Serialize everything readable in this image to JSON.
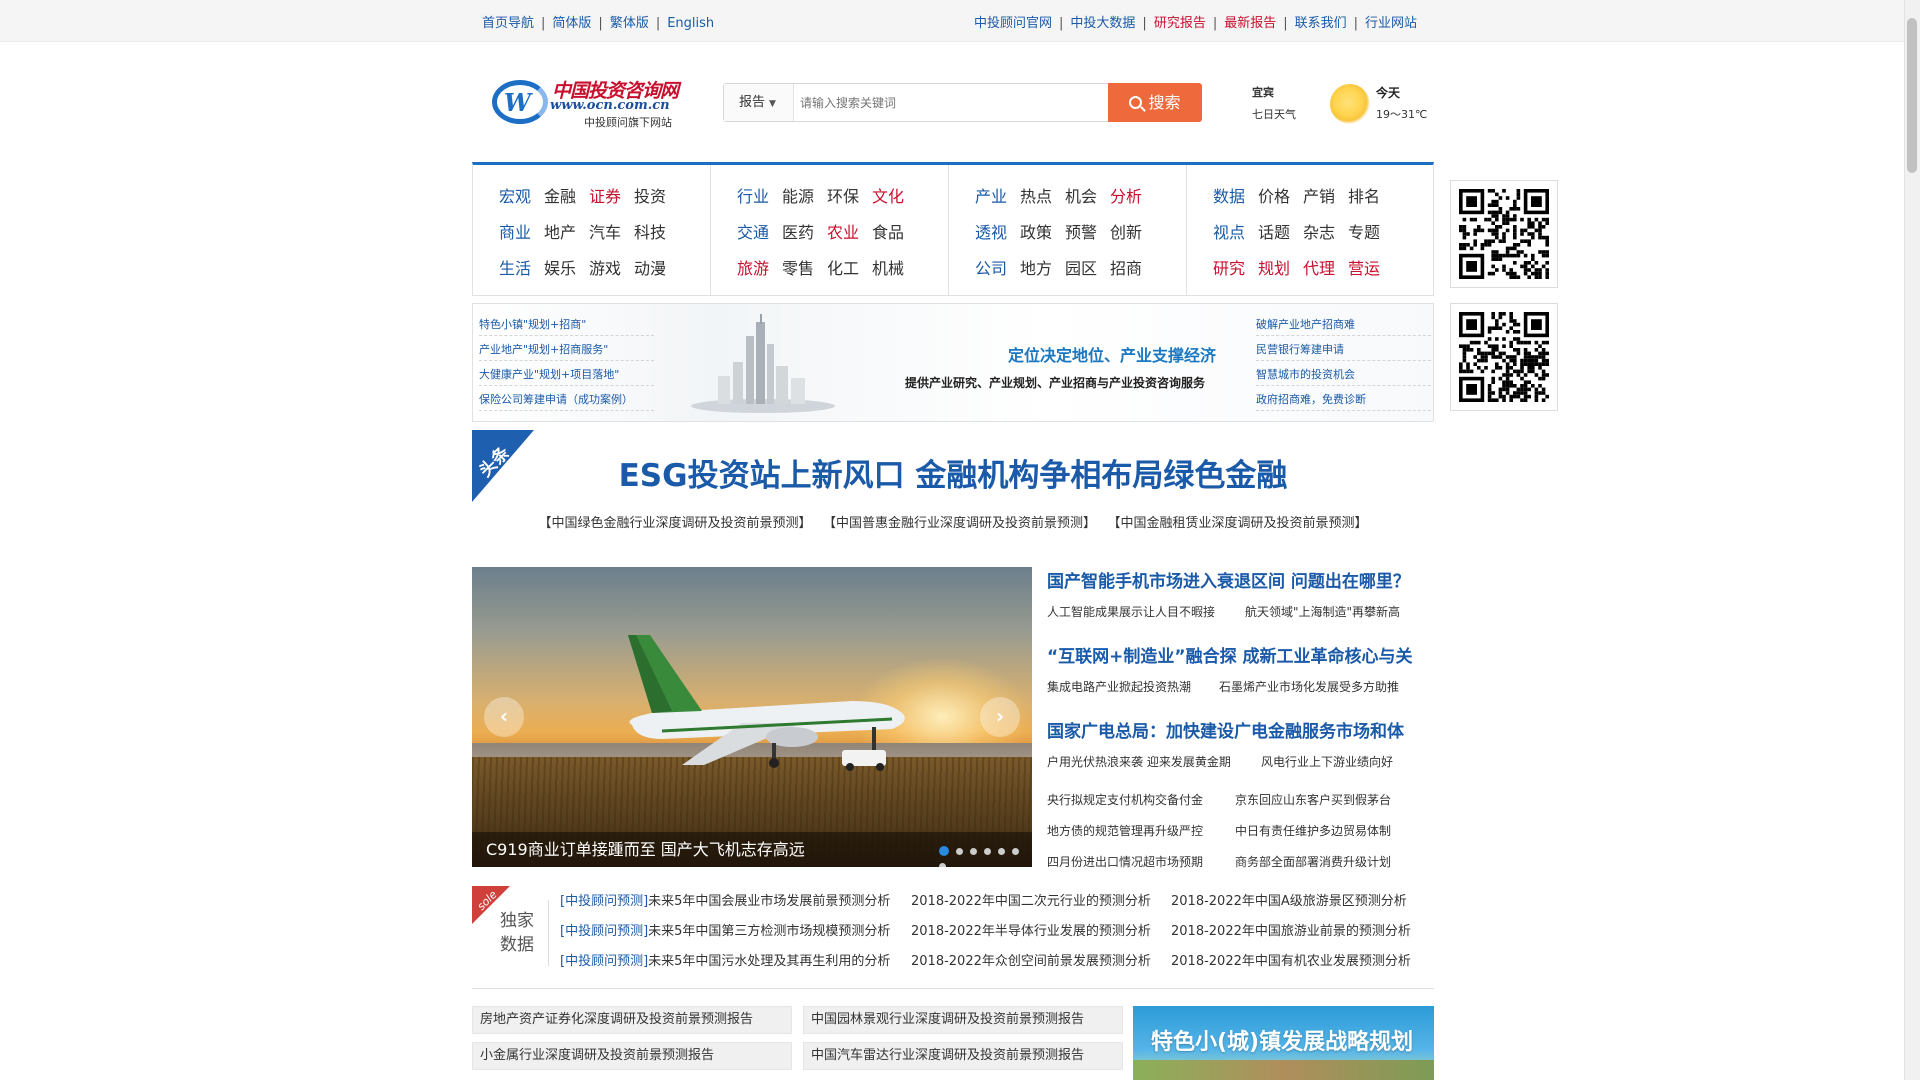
{
  "topbar": {
    "left": [
      "首页导航",
      "简体版",
      "繁体版",
      "English"
    ],
    "right": [
      {
        "label": "中投顾问官网",
        "red": false
      },
      {
        "label": "中投大数据",
        "red": false
      },
      {
        "label": "研究报告",
        "red": true
      },
      {
        "label": "最新报告",
        "red": true
      },
      {
        "label": "联系我们",
        "red": false
      },
      {
        "label": "行业网站",
        "red": false
      }
    ]
  },
  "logo": {
    "name": "中国投资咨询网",
    "url": "www.ocn.com.cn",
    "sub": "中投顾问旗下网站"
  },
  "search": {
    "select_value": "报告",
    "placeholder": "请输入搜索关键词",
    "button": "搜索"
  },
  "weather": {
    "city": "宜宾",
    "label": "七日天气",
    "today": "今天",
    "temp": "19～31℃"
  },
  "categories": [
    [
      [
        {
          "t": "宏观",
          "c": "blue"
        },
        {
          "t": "金融",
          "c": "dark"
        },
        {
          "t": "证券",
          "c": "red"
        },
        {
          "t": "投资",
          "c": "dark"
        }
      ],
      [
        {
          "t": "商业",
          "c": "blue"
        },
        {
          "t": "地产",
          "c": "dark"
        },
        {
          "t": "汽车",
          "c": "dark"
        },
        {
          "t": "科技",
          "c": "dark"
        }
      ],
      [
        {
          "t": "生活",
          "c": "blue"
        },
        {
          "t": "娱乐",
          "c": "dark"
        },
        {
          "t": "游戏",
          "c": "dark"
        },
        {
          "t": "动漫",
          "c": "dark"
        }
      ]
    ],
    [
      [
        {
          "t": "行业",
          "c": "blue"
        },
        {
          "t": "能源",
          "c": "dark"
        },
        {
          "t": "环保",
          "c": "dark"
        },
        {
          "t": "文化",
          "c": "red"
        }
      ],
      [
        {
          "t": "交通",
          "c": "blue"
        },
        {
          "t": "医药",
          "c": "dark"
        },
        {
          "t": "农业",
          "c": "red"
        },
        {
          "t": "食品",
          "c": "dark"
        }
      ],
      [
        {
          "t": "旅游",
          "c": "red"
        },
        {
          "t": "零售",
          "c": "dark"
        },
        {
          "t": "化工",
          "c": "dark"
        },
        {
          "t": "机械",
          "c": "dark"
        }
      ]
    ],
    [
      [
        {
          "t": "产业",
          "c": "blue"
        },
        {
          "t": "热点",
          "c": "dark"
        },
        {
          "t": "机会",
          "c": "dark"
        },
        {
          "t": "分析",
          "c": "red"
        }
      ],
      [
        {
          "t": "透视",
          "c": "blue"
        },
        {
          "t": "政策",
          "c": "dark"
        },
        {
          "t": "预警",
          "c": "dark"
        },
        {
          "t": "创新",
          "c": "dark"
        }
      ],
      [
        {
          "t": "公司",
          "c": "blue"
        },
        {
          "t": "地方",
          "c": "dark"
        },
        {
          "t": "园区",
          "c": "dark"
        },
        {
          "t": "招商",
          "c": "dark"
        }
      ]
    ],
    [
      [
        {
          "t": "数据",
          "c": "blue"
        },
        {
          "t": "价格",
          "c": "dark"
        },
        {
          "t": "产销",
          "c": "dark"
        },
        {
          "t": "排名",
          "c": "dark"
        }
      ],
      [
        {
          "t": "视点",
          "c": "blue"
        },
        {
          "t": "话题",
          "c": "dark"
        },
        {
          "t": "杂志",
          "c": "dark"
        },
        {
          "t": "专题",
          "c": "dark"
        }
      ],
      [
        {
          "t": "研究",
          "c": "red"
        },
        {
          "t": "规划",
          "c": "red"
        },
        {
          "t": "代理",
          "c": "red"
        },
        {
          "t": "营运",
          "c": "red"
        }
      ]
    ]
  ],
  "banner": {
    "left_links": [
      "特色小镇\"规划+招商\"",
      "产业地产\"规划+招商服务\"",
      "大健康产业\"规划+项目落地\"",
      "保险公司筹建申请（成功案例）"
    ],
    "right_links": [
      "破解产业地产招商难",
      "民营银行筹建申请",
      "智慧城市的投资机会",
      "政府招商难，免费诊断"
    ],
    "slogan": "定位决定地位、产业支撑经济",
    "slogan2": "提供产业研究、产业规划、产业招商与产业投资咨询服务"
  },
  "ribbon": "头条",
  "headline": "ESG投资站上新风口 金融机构争相布局绿色金融",
  "reports": [
    "【中国绿色金融行业深度调研及投资前景预测】",
    "【中国普惠金融行业深度调研及投资前景预测】",
    "【中国金融租赁业深度调研及投资前景预测】"
  ],
  "slider": {
    "caption": "C919商业订单接踵而至 国产大飞机志存高远",
    "prev": "‹",
    "next": "›",
    "dot_count": 7,
    "active_dot": 1
  },
  "news": {
    "items": [
      {
        "headline": "国产智能手机市场进入衰退区间 问题出在哪里？",
        "subs": [
          "人工智能成果展示让人目不暇接",
          "航天领域\"上海制造\"再攀新高"
        ]
      },
      {
        "headline": "“互联网+制造业”融合探 成新工业革命核心与关",
        "subs": [
          "集成电路产业掀起投资热潮",
          "石墨烯产业市场化发展受多方助推"
        ]
      },
      {
        "headline": "国家广电总局：加快建设广电金融服务市场和体",
        "subs": [
          "户用光伏热浪来袭 迎来发展黄金期",
          "风电行业上下游业绩向好"
        ]
      }
    ],
    "more": [
      [
        "央行拟规定支付机构交备付金",
        "京东回应山东客户买到假茅台"
      ],
      [
        "地方债的规范管理再升级严控",
        "中日有责任维护多边贸易体制"
      ],
      [
        "四月份进出口情况超市场预期",
        "商务部全面部署消费升级计划"
      ]
    ]
  },
  "sole": {
    "tag": "sole",
    "line1": "独家",
    "line2": "数据"
  },
  "exclusive": [
    {
      "tag": "[中投顾问预测]",
      "c1": "未来5年中国会展业市场发展前景预测分析",
      "c2": "2018-2022年中国二次元行业的预测分析",
      "c3": "2018-2022年中国A级旅游景区预测分析"
    },
    {
      "tag": "[中投顾问预测]",
      "c1": "未来5年中国第三方检测市场规模预测分析",
      "c2": "2018-2022年半导体行业发展的预测分析",
      "c3": "2018-2022年中国旅游业前景的预测分析"
    },
    {
      "tag": "[中投顾问预测]",
      "c1": "未来5年中国污水处理及其再生利用的分析",
      "c2": "2018-2022年众创空间前景发展预测分析",
      "c3": "2018-2022年中国有机农业发展预测分析"
    }
  ],
  "report_list": [
    [
      "房地产资产证券化深度调研及投资前景预测报告",
      "小金属行业深度调研及投资前景预测报告"
    ],
    [
      "中国园林景观行业深度调研及投资前景预测报告",
      "中国汽车雷达行业深度调研及投资前景预测报告"
    ]
  ],
  "ad": {
    "title": "特色小(城)镇发展战略规划"
  }
}
